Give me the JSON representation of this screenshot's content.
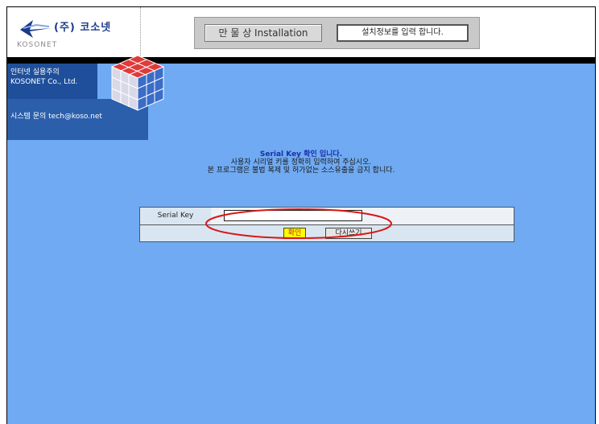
{
  "header": {
    "logo_korean": "(주) 코소넷",
    "logo_english": "KOSONET",
    "installation_button": "만 물 상 Installation",
    "status_text": "설치정보를 입력 합니다."
  },
  "sidebar": {
    "top_line1": "인터넷 실용주의",
    "top_line2": "KOSONET Co., Ltd.",
    "contact": "시스템 문의 tech@koso.net"
  },
  "main": {
    "heading": "Serial Key 확인 입니다.",
    "instruction1": "사용자 시리얼 키를 정확히 입력하여 주십시오.",
    "instruction2": "본 프로그램은 불법 복제 및 허가없는 소스유출을 금지 합니다."
  },
  "form": {
    "serial_label": "Serial Key",
    "serial_value": "",
    "confirm_label": "확인",
    "retype_label": "다시쓰기"
  },
  "colors": {
    "background": "#6faaf2",
    "sidebar_dark": "#1f4f9a",
    "heading_blue": "#1a2fa8",
    "annotation_red": "#d81818",
    "confirm_yellow": "#ffff00"
  }
}
